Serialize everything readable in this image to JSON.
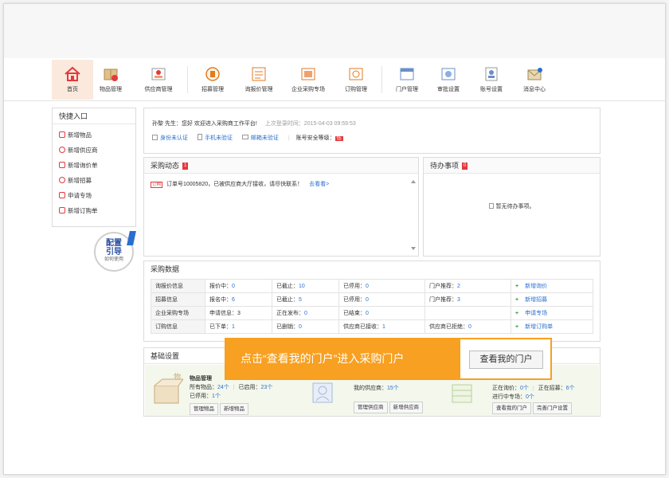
{
  "nav": {
    "items": [
      {
        "label": "首页"
      },
      {
        "label": "物品管理"
      },
      {
        "label": "供应商管理"
      },
      {
        "label": "招募管理"
      },
      {
        "label": "询报价管理"
      },
      {
        "label": "企业采购专场"
      },
      {
        "label": "订购管理"
      },
      {
        "label": "门户管理"
      },
      {
        "label": "审批设置"
      },
      {
        "label": "账号设置"
      },
      {
        "label": "消息中心"
      }
    ]
  },
  "quick": {
    "title": "快捷入口",
    "items": [
      {
        "label": "新增物品"
      },
      {
        "label": "新增供应商"
      },
      {
        "label": "新增询价单"
      },
      {
        "label": "新增招募"
      },
      {
        "label": "申请专场"
      },
      {
        "label": "新增订购单"
      }
    ]
  },
  "guide": {
    "line1": "配置",
    "line2": "引导",
    "line3": "如何使用"
  },
  "welcome": {
    "text": "孙黎 先生：您好 欢迎进入采购商工作平台!",
    "last_login_label": "上次登录时间：",
    "last_login": "2015-04-03 09:59:53",
    "verify": [
      "身份未认证",
      "手机未验证",
      "邮箱未验证"
    ],
    "security_label": "账号安全等级：",
    "security_level": "低"
  },
  "dynamics": {
    "title": "采购动态",
    "count": "1",
    "tag": "订购",
    "message": "订单号10005820，已被供应商大厅接收，请尽快联系！",
    "link": "去看看>"
  },
  "todo": {
    "title": "待办事项",
    "count": "0",
    "empty": "暂无待办事项。"
  },
  "pdata": {
    "title": "采购数据",
    "rows": [
      {
        "head": "询报价信息",
        "c1": "报价中：",
        "v1": "0",
        "c2": "已截止：",
        "v2": "10",
        "c3": "已停用：",
        "v3": "0",
        "c4": "门户推荐：",
        "v4": "2",
        "action": "新增询价"
      },
      {
        "head": "招募信息",
        "c1": "报名中：",
        "v1": "6",
        "c2": "已截止：",
        "v2": "5",
        "c3": "已停用：",
        "v3": "0",
        "c4": "门户推荐：",
        "v4": "3",
        "action": "新增招募"
      },
      {
        "head": "企业采购专场",
        "c1": "申请信息：",
        "v1": "3",
        "c2": "正在发布：",
        "v2": "0",
        "c3": "已结束：",
        "v3": "0",
        "c4": "",
        "v4": "",
        "action": "申请专场"
      },
      {
        "head": "订购信息",
        "c1": "已下单：",
        "v1": "1",
        "c2": "已删销：",
        "v2": "0",
        "c3": "供应商已接收：",
        "v3": "1",
        "c4": "供应商已拒绝：",
        "v4": "0",
        "action": "新增订购单"
      }
    ]
  },
  "basic": {
    "title": "基础设置",
    "items": {
      "title": "物品管理",
      "all_label": "所有物品：",
      "all": "24个",
      "enabled_label": "已启用：",
      "enabled": "23个",
      "disabled_label": "已停用：",
      "disabled": "1个",
      "btn1": "管理物品",
      "btn2": "新增物品"
    },
    "suppliers": {
      "my_label": "我的供应商：",
      "my": "15个",
      "btn1": "管理供应商",
      "btn2": "新增供应商"
    },
    "portal": {
      "c1_label": "正在询价：",
      "c1": "0个",
      "c2_label": "正在招募：",
      "c2": "6个",
      "c3_label": "进行中专场：",
      "c3": "0个",
      "btn1": "查看我的门户",
      "btn2": "完善门户设置"
    }
  },
  "tip": {
    "text": "点击“查看我的门户”进入采购门户",
    "button": "查看我的门户"
  }
}
